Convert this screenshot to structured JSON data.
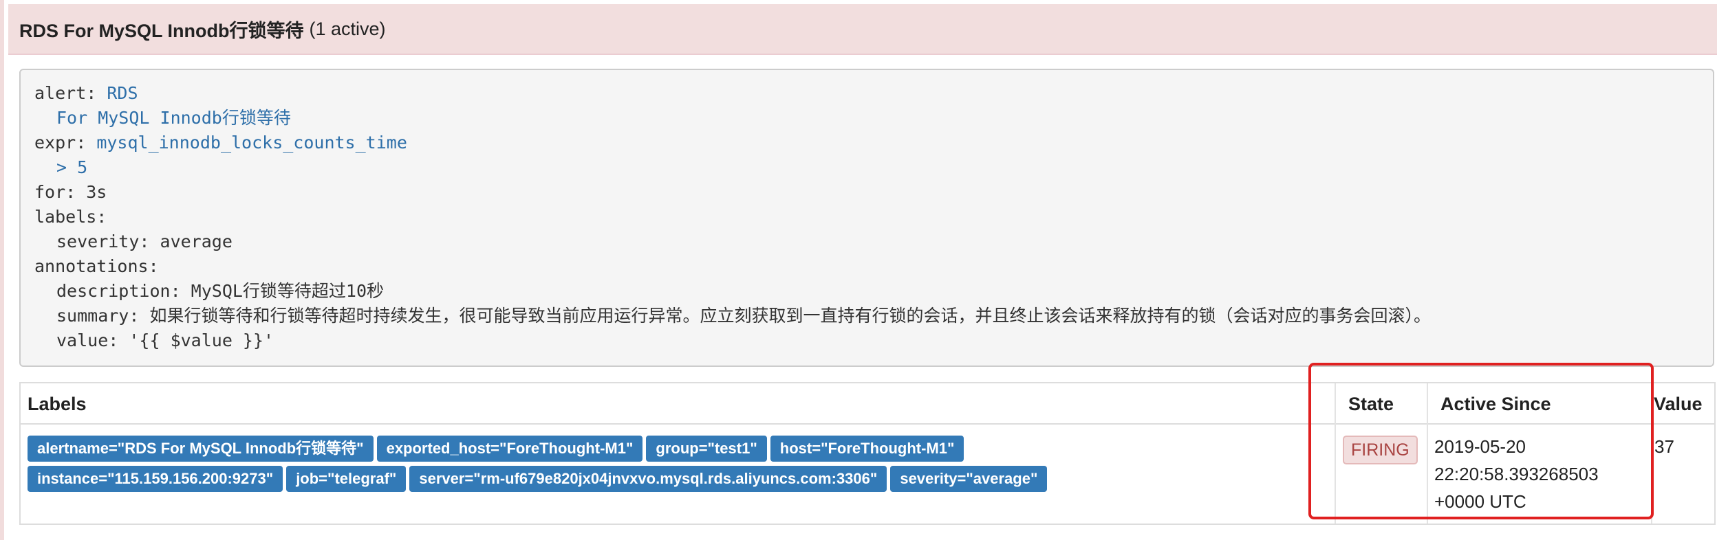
{
  "header": {
    "title": "RDS For MySQL Innodb行锁等待",
    "active_count": "(1 active)"
  },
  "rule": {
    "alert_key": "alert:",
    "alert_value_1": "RDS",
    "alert_value_2": "For MySQL Innodb行锁等待",
    "expr_key": "expr:",
    "expr_value_1": "mysql_innodb_locks_counts_time",
    "expr_value_2": "> 5",
    "for_line": "for: 3s",
    "labels_key": "labels:",
    "severity_line": "severity: average",
    "annotations_key": "annotations:",
    "description_line": "description: MySQL行锁等待超过10秒",
    "summary_line": "summary: 如果行锁等待和行锁等待超时持续发生，很可能导致当前应用运行异常。应立刻获取到一直持有行锁的会话，并且终止该会话来释放持有的锁（会话对应的事务会回滚）。",
    "value_line": "value: '{{ $value }}'"
  },
  "table": {
    "headers": {
      "labels": "Labels",
      "state": "State",
      "active_since": "Active Since",
      "value": "Value"
    },
    "row": {
      "labels": [
        "alertname=\"RDS For MySQL Innodb行锁等待\"",
        "exported_host=\"ForeThought-M1\"",
        "group=\"test1\"",
        "host=\"ForeThought-M1\"",
        "instance=\"115.159.156.200:9273\"",
        "job=\"telegraf\"",
        "server=\"rm-uf679e820jx04jnvxvo.mysql.rds.aliyuncs.com:3306\"",
        "severity=\"average\""
      ],
      "state": "FIRING",
      "active_since_date": "2019-05-20",
      "active_since_time": "22:20:58.393268503",
      "active_since_tz": "+0000 UTC",
      "value": "37"
    }
  },
  "colors": {
    "header_bg": "#f2dede",
    "chip_bg": "#337ab7",
    "firing_text": "#a94442",
    "highlight": "#e02020"
  }
}
